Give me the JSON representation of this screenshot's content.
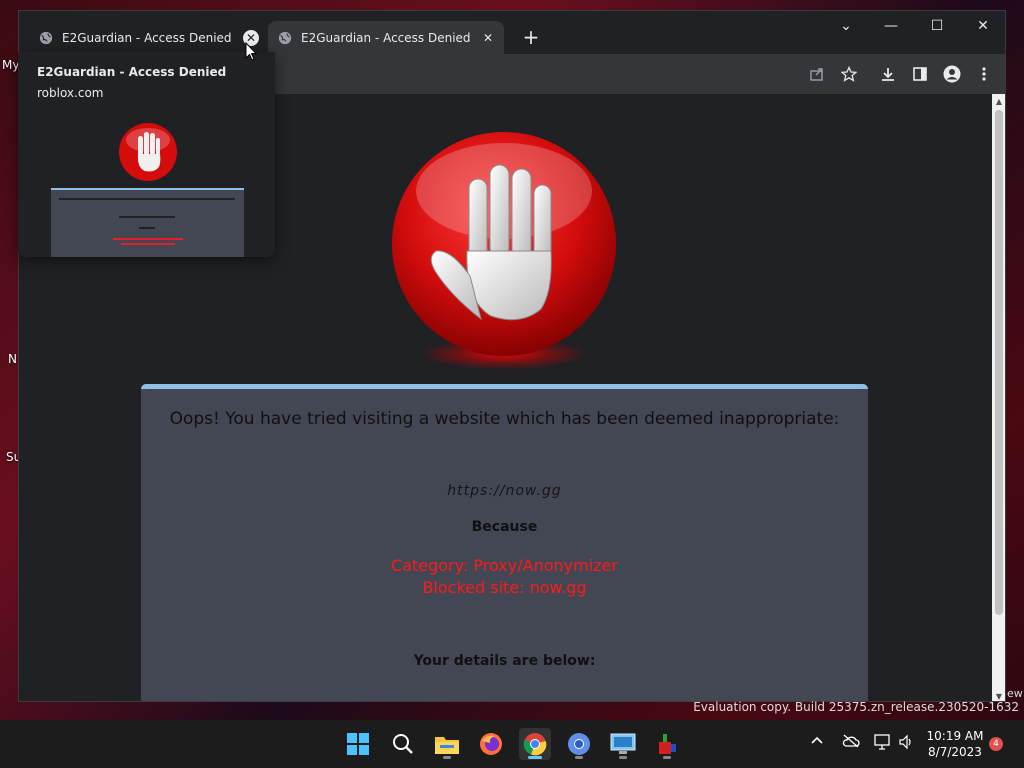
{
  "desktop": {
    "labels": [
      "My",
      "N",
      "Su"
    ],
    "watermark": "Evaluation copy. Build 25375.zn_release.230520-1632",
    "edge_text": "ew"
  },
  "browser": {
    "tabs": [
      {
        "title": "E2Guardian - Access Denied",
        "active": false,
        "close_glyph": "✕"
      },
      {
        "title": "E2Guardian - Access Denied",
        "active": true,
        "close_glyph": "✕"
      }
    ],
    "new_tab_glyph": "+",
    "window_controls": {
      "tab_search": "⌄",
      "minimize": "—",
      "maximize": "☐",
      "close": "✕"
    },
    "toolbar_icons": [
      "share-icon",
      "star-icon",
      "download-icon",
      "side-panel-icon",
      "profile-icon",
      "menu-icon"
    ],
    "hover_card": {
      "title": "E2Guardian - Access Denied",
      "domain": "roblox.com"
    }
  },
  "page": {
    "headline": "Oops! You have tried visiting a website which has been deemed inappropriate:",
    "url": "https://now.gg",
    "because": "Because",
    "category": "Category: Proxy/Anonymizer",
    "blocked_site": "Blocked site: now.gg",
    "details": "Your details are below:"
  },
  "taskbar": {
    "apps": [
      "start-icon",
      "search-icon",
      "file-explorer-icon",
      "firefox-icon",
      "chrome-icon",
      "chrome-alt-icon",
      "remote-desktop-icon",
      "app-icon"
    ],
    "active_app": "chrome-icon",
    "time": "10:19 AM",
    "date": "8/7/2023",
    "notification_count": "4"
  },
  "colors": {
    "accent_blue": "#8ec0e6",
    "alert_red": "#ff1a1a",
    "panel_bg": "#434753"
  }
}
